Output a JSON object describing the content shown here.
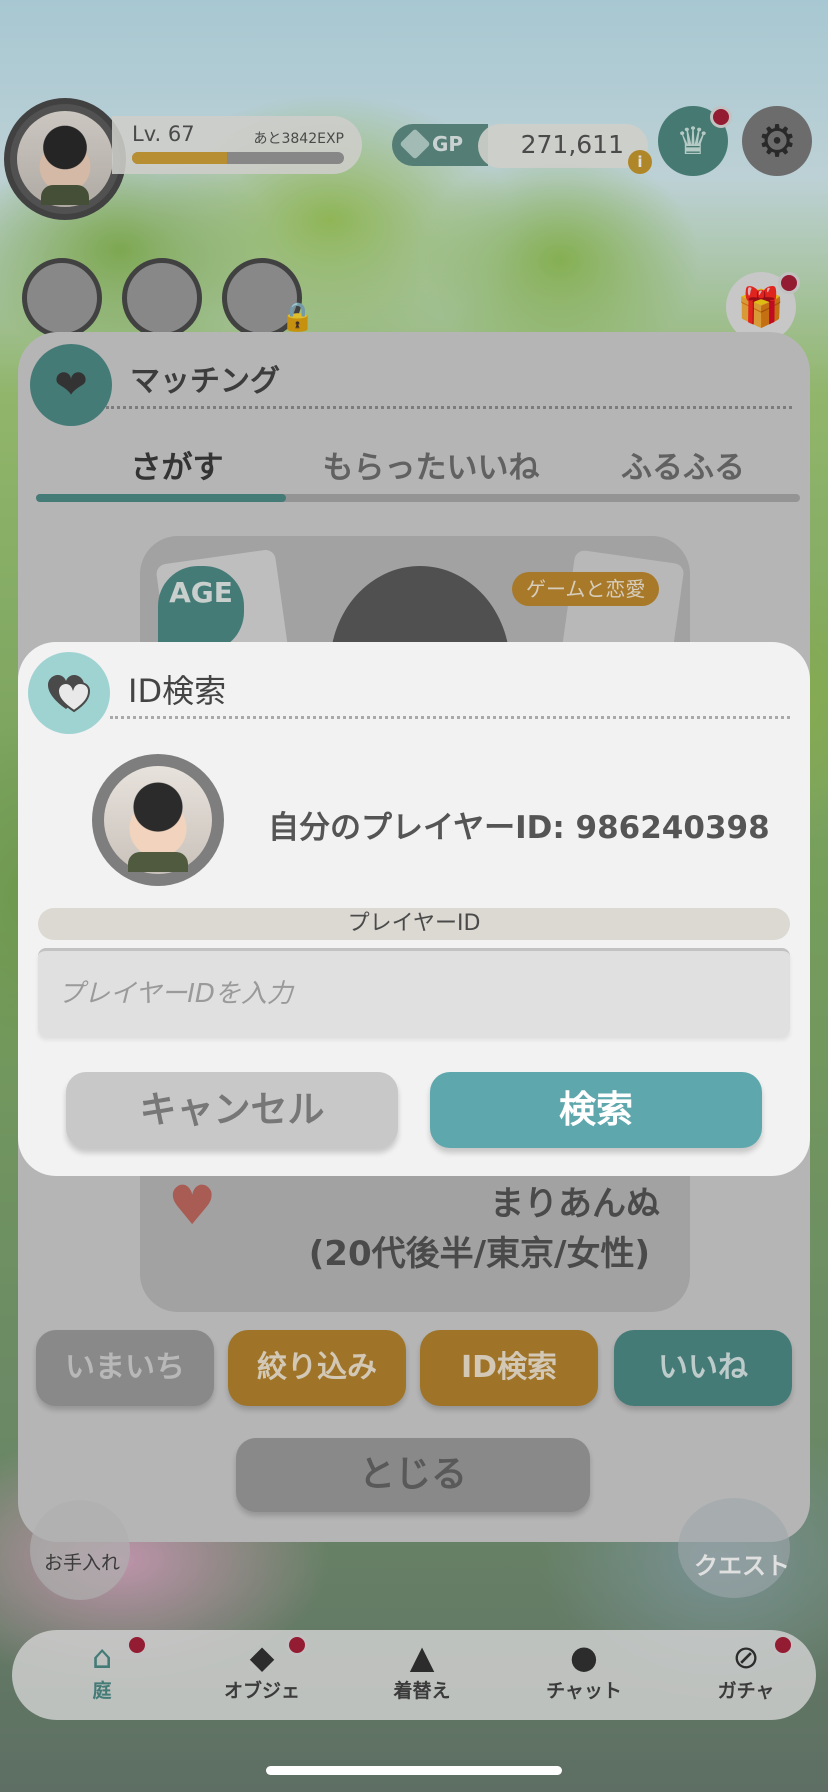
{
  "hud": {
    "level": "Lv. 67",
    "exp_remaining": "あと3842EXP",
    "exp_progress": 0.45,
    "gp_label": "GP",
    "gp_value": "271,611",
    "gp_info": "i"
  },
  "matching_panel": {
    "title": "マッチング",
    "tabs": [
      "さがす",
      "もらったいいね",
      "ふるふる"
    ],
    "active_tab": 0,
    "card": {
      "age_badge": "AGE",
      "tag": "ゲームと恋愛",
      "name": "まりあんぬ",
      "subtitle": "(20代後半/東京/女性)"
    },
    "actions": {
      "now": "いまいち",
      "filter": "絞り込み",
      "id_search": "ID検索",
      "like": "いいね"
    },
    "close_label": "とじる"
  },
  "dialog": {
    "title": "ID検索",
    "own_player_id": "自分のプレイヤーID: 986240398",
    "field_label": "プレイヤーID",
    "input_placeholder": "プレイヤーIDを入力",
    "input_value": "",
    "cancel_label": "キャンセル",
    "search_label": "検索"
  },
  "side": {
    "care_label": "お手入れ",
    "quest_label": "クエスト"
  },
  "nav": {
    "items": [
      {
        "label": "庭",
        "icon": "house-icon",
        "badge": true
      },
      {
        "label": "オブジェ",
        "icon": "object-icon",
        "badge": true
      },
      {
        "label": "着替え",
        "icon": "clothes-icon",
        "badge": false
      },
      {
        "label": "チャット",
        "icon": "chat-icon",
        "badge": false
      },
      {
        "label": "ガチャ",
        "icon": "gacha-icon",
        "badge": true
      }
    ],
    "active_index": 0
  },
  "colors": {
    "accent_teal": "#5ea7ad",
    "amber": "#c08a2e",
    "badge_red": "#a8203a"
  }
}
